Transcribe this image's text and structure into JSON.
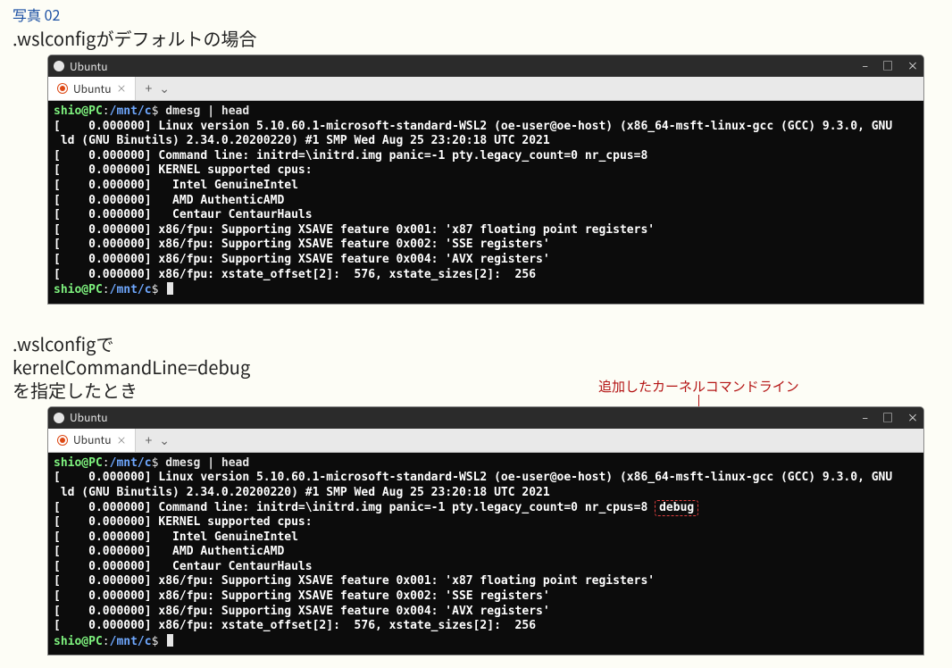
{
  "photo_label": "写真 02",
  "caption1": ".wslconfigがデフォルトの場合",
  "caption2_line1": ".wslconfigで",
  "caption2_line2": "kernelCommandLine=debug",
  "caption2_line3": "を指定したとき",
  "annotation_label": "追加したカーネルコマンドライン",
  "window": {
    "title_glyph": "🐧",
    "title": "Ubuntu",
    "tab_label": "Ubuntu",
    "tab_close": "×",
    "tab_plus": "+",
    "tab_chevron": "⌄",
    "ctrl_min": "–",
    "ctrl_max": "□",
    "ctrl_close": "×"
  },
  "prompt": {
    "user_host": "shio@PC",
    "colon1": ":",
    "path": "/mnt/c",
    "dollar": "$",
    "cmd": "dmesg | head"
  },
  "out_common": {
    "l1": "[    0.000000] Linux version 5.10.60.1-microsoft-standard-WSL2 (oe-user@oe-host) (x86_64-msft-linux-gcc (GCC) 9.3.0, GNU",
    "l2": " ld (GNU Binutils) 2.34.0.20200220) #1 SMP Wed Aug 25 23:20:18 UTC 2021",
    "l4": "[    0.000000] KERNEL supported cpus:",
    "l5": "[    0.000000]   Intel GenuineIntel",
    "l6": "[    0.000000]   AMD AuthenticAMD",
    "l7": "[    0.000000]   Centaur CentaurHauls",
    "l8": "[    0.000000] x86/fpu: Supporting XSAVE feature 0x001: 'x87 floating point registers'",
    "l9": "[    0.000000] x86/fpu: Supporting XSAVE feature 0x002: 'SSE registers'",
    "l10": "[    0.000000] x86/fpu: Supporting XSAVE feature 0x004: 'AVX registers'",
    "l11": "[    0.000000] x86/fpu: xstate_offset[2]:  576, xstate_sizes[2]:  256"
  },
  "out1_cmdline": "[    0.000000] Command line: initrd=\\initrd.img panic=-1 pty.legacy_count=0 nr_cpus=8",
  "out2_cmdline_pre": "[    0.000000] Command line: initrd=\\initrd.img panic=-1 pty.legacy_count=0 nr_cpus=8 ",
  "out2_cmdline_debug": "debug"
}
